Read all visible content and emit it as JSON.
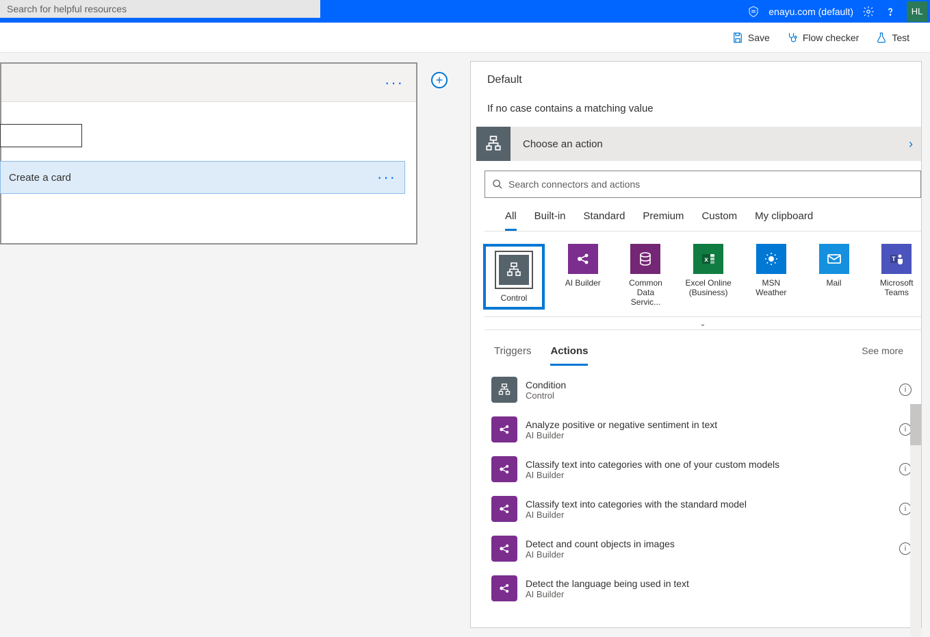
{
  "topbar": {
    "search_placeholder": "Search for helpful resources",
    "tenant": "enayu.com (default)",
    "avatar": "HL"
  },
  "toolbar": {
    "save": "Save",
    "flow_checker": "Flow checker",
    "test": "Test"
  },
  "left": {
    "create_card": "Create a card"
  },
  "panel": {
    "title": "Default",
    "subtitle": "If no case contains a matching value",
    "choose": "Choose an action",
    "search_placeholder": "Search connectors and actions",
    "tabs": [
      "All",
      "Built-in",
      "Standard",
      "Premium",
      "Custom",
      "My clipboard"
    ],
    "active_tab": 0,
    "connectors": [
      {
        "label": "Control",
        "color": "grey",
        "selected": true
      },
      {
        "label": "AI Builder",
        "color": "purple"
      },
      {
        "label": "Common Data Servic...",
        "color": "darkp"
      },
      {
        "label": "Excel Online (Business)",
        "color": "green"
      },
      {
        "label": "MSN Weather",
        "color": "blue"
      },
      {
        "label": "Mail",
        "color": "bluegr"
      },
      {
        "label": "Microsoft Teams",
        "color": "teams"
      }
    ],
    "sub_tabs": {
      "triggers": "Triggers",
      "actions": "Actions",
      "see_more": "See more"
    },
    "actions": [
      {
        "title": "Condition",
        "sub": "Control",
        "color": "grey"
      },
      {
        "title": "Analyze positive or negative sentiment in text",
        "sub": "AI Builder",
        "color": "purple"
      },
      {
        "title": "Classify text into categories with one of your custom models",
        "sub": "AI Builder",
        "color": "purple"
      },
      {
        "title": "Classify text into categories with the standard model",
        "sub": "AI Builder",
        "color": "purple"
      },
      {
        "title": "Detect and count objects in images",
        "sub": "AI Builder",
        "color": "purple"
      },
      {
        "title": "Detect the language being used in text",
        "sub": "AI Builder",
        "color": "purple"
      }
    ]
  }
}
